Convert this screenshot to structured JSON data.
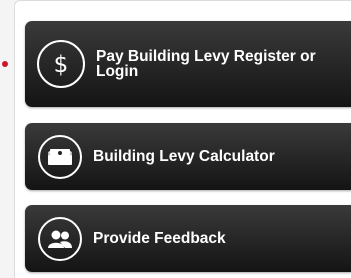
{
  "menu": {
    "buttons": [
      {
        "label": "Pay Building Levy Register or Login",
        "icon": "dollar-icon"
      },
      {
        "label": "Building Levy Calculator",
        "icon": "cash-icon"
      },
      {
        "label": "Provide Feedback",
        "icon": "people-icon"
      }
    ]
  },
  "colors": {
    "button_bg": "#1e1e1e",
    "button_text": "#ffffff",
    "accent_dot": "#d0142b"
  }
}
